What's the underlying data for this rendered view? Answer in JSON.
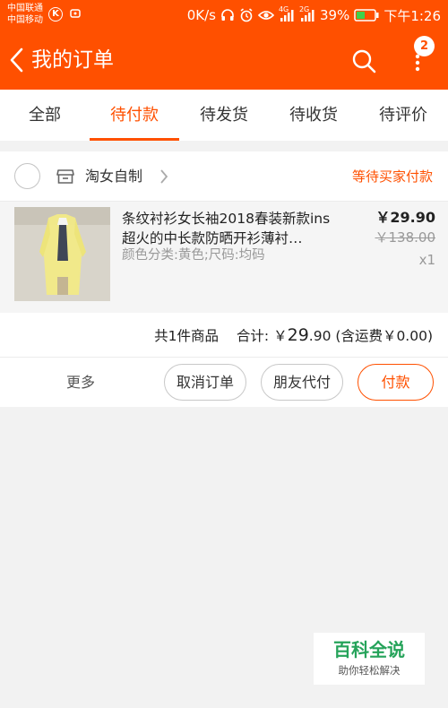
{
  "status_bar": {
    "carrier_1": "中国联通",
    "carrier_2": "中国移动",
    "k_badge": "K",
    "speed": "0K/s",
    "net_4g": "4G",
    "net_2g": "2G",
    "battery": "39%",
    "time": "下午1:26",
    "icons": [
      "headset-icon",
      "alarm-icon",
      "eye-icon",
      "signal-icon",
      "battery-icon"
    ]
  },
  "header": {
    "title": "我的订单",
    "badge_count": "2",
    "icons": [
      "back-arrow-icon",
      "search-icon",
      "more-vertical-icon"
    ]
  },
  "tabs": [
    {
      "label": "全部",
      "active": false
    },
    {
      "label": "待付款",
      "active": true
    },
    {
      "label": "待发货",
      "active": false
    },
    {
      "label": "待收货",
      "active": false
    },
    {
      "label": "待评价",
      "active": false
    }
  ],
  "order": {
    "shop_name": "淘女自制",
    "status": "等待买家付款",
    "item": {
      "title": "条纹衬衫女长袖2018春装新款ins超火的中长款防晒开衫薄衬…",
      "spec": "颜色分类:黄色;尺码:均码",
      "price": "￥29.90",
      "original_price": "￥138.00",
      "quantity": "x1"
    },
    "summary": {
      "count": "共1件商品",
      "total_label": "合计:",
      "currency": "￥",
      "total_int": "29",
      "total_dec": ".90",
      "shipping": "(含运费￥0.00)"
    },
    "actions": {
      "more": "更多",
      "cancel": "取消订单",
      "friend_pay": "朋友代付",
      "pay": "付款"
    }
  },
  "watermark": {
    "title": "百科全说",
    "subtitle": "助你轻松解决"
  },
  "colors": {
    "accent": "#ff5000",
    "watermark_green": "#25a35a"
  }
}
